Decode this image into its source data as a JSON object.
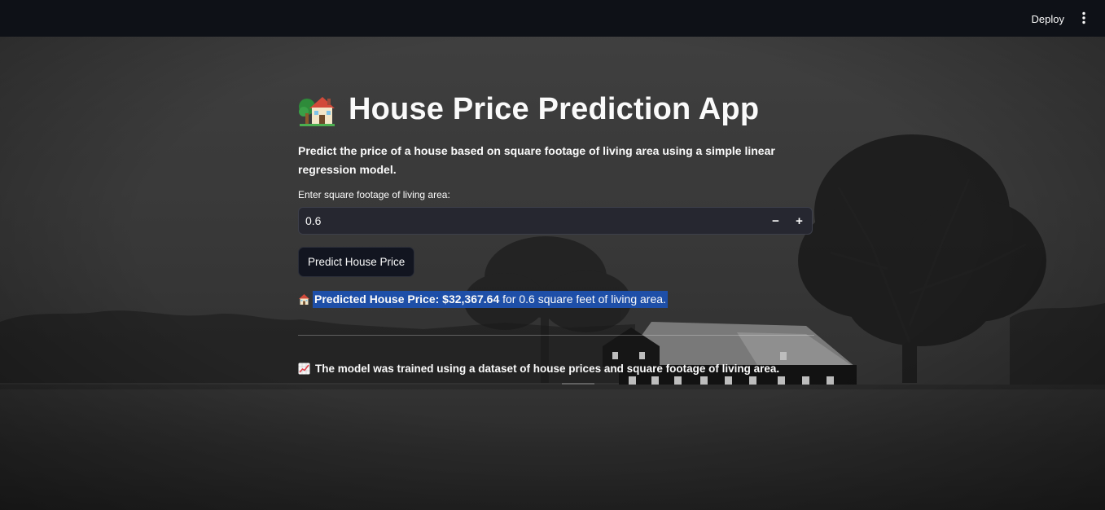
{
  "header": {
    "deploy_label": "Deploy",
    "menu_icon": "kebab-menu-icon"
  },
  "main": {
    "title_icon": "house-with-garden-icon",
    "title": "House Price Prediction App",
    "subtitle": "Predict the price of a house based on square footage of living area using a simple linear regression model.",
    "input": {
      "label": "Enter square footage of living area:",
      "value": "0.6",
      "minus_label": "−",
      "plus_label": "+"
    },
    "predict_button_label": "Predict House Price",
    "result": {
      "icon": "house-icon",
      "bold_text": "Predicted House Price: $32,367.64",
      "rest_text": " for 0.6 square feet of living area."
    },
    "footnote": {
      "icon": "chart-increasing-icon",
      "text": "The model was trained using a dataset of house prices and square footage of living area."
    }
  },
  "colors": {
    "header_bg": "#0e1117",
    "input_bg": "#262730",
    "button_bg": "#121520",
    "highlight": "#1e4fa8",
    "text": "#fafafa"
  }
}
